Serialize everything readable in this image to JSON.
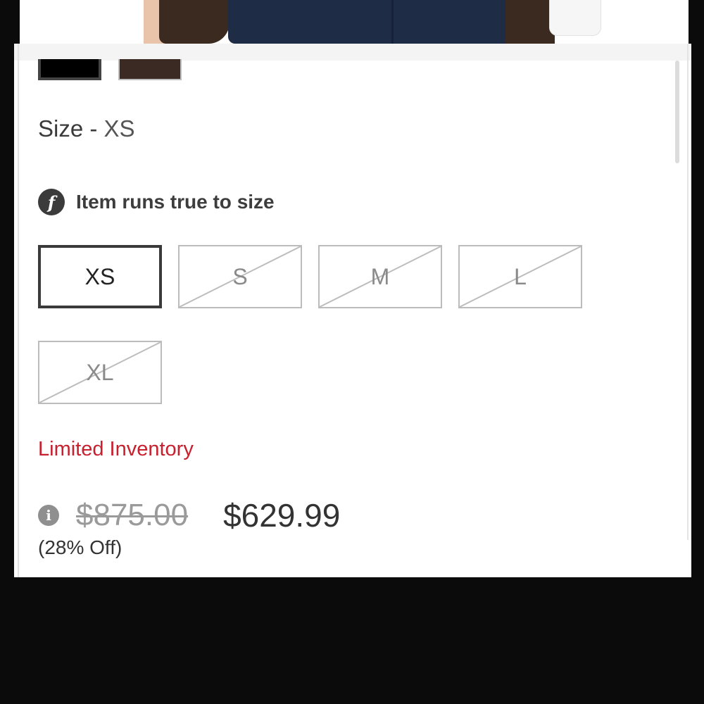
{
  "product": {
    "color_swatches": [
      {
        "name": "black",
        "color": "#000000",
        "selected": true
      },
      {
        "name": "brown",
        "color": "#3b2a24",
        "selected": false
      }
    ],
    "size_prefix": "Size - ",
    "size_selected": "XS",
    "fit_icon_glyph": "f",
    "fit_text": "Item runs true to size",
    "sizes": [
      {
        "label": "XS",
        "available": true,
        "selected": true
      },
      {
        "label": "S",
        "available": false,
        "selected": false
      },
      {
        "label": "M",
        "available": false,
        "selected": false
      },
      {
        "label": "L",
        "available": false,
        "selected": false
      },
      {
        "label": "XL",
        "available": false,
        "selected": false
      }
    ],
    "inventory_status": "Limited Inventory",
    "info_icon_glyph": "i",
    "original_price": "$875.00",
    "sale_price": "$629.99",
    "discount": "(28% Off)"
  },
  "colors": {
    "inventory_red": "#c8202e",
    "text_dark": "#333333",
    "unavailable_gray": "#bcbcbc"
  }
}
